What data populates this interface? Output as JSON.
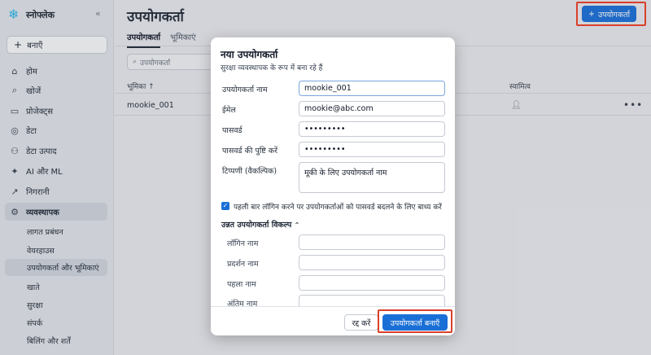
{
  "sidebar": {
    "brand": "स्नोफ्लेक",
    "collapse_icon": "«",
    "new_button": "बनाएँ",
    "items": [
      {
        "icon": "home-icon",
        "glyph": "⌂",
        "label": "होम"
      },
      {
        "icon": "search-icon",
        "glyph": "⌕",
        "label": "खोजें"
      },
      {
        "icon": "folder-icon",
        "glyph": "▭",
        "label": "प्रोजेक्ट्स"
      },
      {
        "icon": "database-icon",
        "glyph": "◎",
        "label": "डेटा"
      },
      {
        "icon": "data-products-icon",
        "glyph": "⚇",
        "label": "डेटा उत्पाद"
      },
      {
        "icon": "ai-ml-icon",
        "glyph": "✦",
        "label": "AI और ML"
      },
      {
        "icon": "monitoring-icon",
        "glyph": "↗",
        "label": "निगरानी"
      },
      {
        "icon": "admin-gear-icon",
        "glyph": "⚙",
        "label": "व्यवस्थापक"
      }
    ],
    "sub_items": [
      {
        "label": "लागत प्रबंधन"
      },
      {
        "label": "वेयरहाउस"
      },
      {
        "label": "उपयोगकर्ता और भूमिकाएं"
      },
      {
        "label": "खाते"
      },
      {
        "label": "सुरक्षा"
      },
      {
        "label": "संपर्क"
      },
      {
        "label": "बिलिंग और शर्तें"
      }
    ]
  },
  "main": {
    "title": "उपयोगकर्ता",
    "create_button": "उपयोगकर्ता",
    "tabs": [
      {
        "label": "उपयोगकर्ता"
      },
      {
        "label": "भूमिकाएं"
      }
    ],
    "search_placeholder": "उपयोगकर्ता",
    "columns": {
      "role": "भूमिका ↑",
      "owner": "स्वामित्व"
    },
    "rows": [
      {
        "name": "mookie_001"
      }
    ]
  },
  "modal": {
    "title": "नया उपयोगकर्ता",
    "subtitle": "सुरक्षा व्यवस्थापक के रूप में बना रहे हैं",
    "fields": {
      "username_label": "उपयोगकर्ता नाम",
      "username_value": "mookie_001",
      "email_label": "ईमेल",
      "email_value": "mookie@abc.com",
      "password_label": "पासवर्ड",
      "password_value": "•••••••••",
      "confirm_label": "पासवर्ड की पुष्टि करें",
      "confirm_value": "•••••••••",
      "comment_label": "टिप्पणी (वैकल्पिक)",
      "comment_value": "मूकी के लिए उपयोगकर्ता नाम"
    },
    "force_reset_label": "पहली बार लॉगिन करने पर उपयोगकर्ताओं को पासवर्ड बदलने के लिए बाध्य करें",
    "advanced_label": "उन्नत उपयोगकर्ता विकल्प",
    "advanced_fields": [
      {
        "label": "लॉगिन नाम"
      },
      {
        "label": "प्रदर्शन नाम"
      },
      {
        "label": "पहला नाम"
      },
      {
        "label": "अंतिम नाम"
      }
    ],
    "cancel_button": "रद्द करें",
    "create_button": "उपयोगकर्ता बनाएँ"
  },
  "colors": {
    "accent": "#1a6fd6",
    "highlight": "#d9402b"
  }
}
